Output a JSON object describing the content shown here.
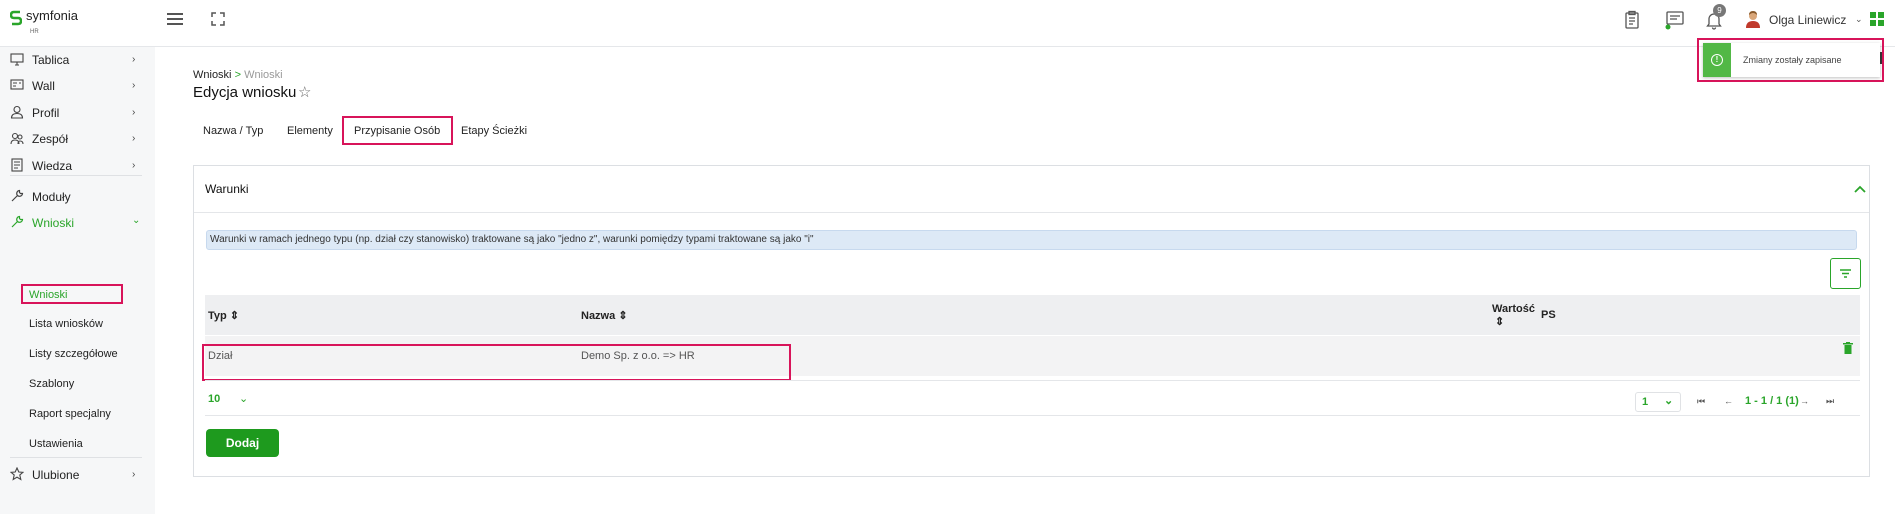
{
  "brand": {
    "name": "symfonia",
    "sub": "HR"
  },
  "header": {
    "user_name": "Olga Liniewicz",
    "notification_count": "9",
    "icons": [
      "hamburger-icon",
      "fullscreen-icon",
      "clipboard-icon",
      "chat-icon",
      "bell-icon",
      "apps-icon"
    ]
  },
  "sidebar": {
    "items": [
      {
        "label": "Tablica",
        "icon": "monitor-icon"
      },
      {
        "label": "Wall",
        "icon": "wall-icon"
      },
      {
        "label": "Profil",
        "icon": "user-icon"
      },
      {
        "label": "Zespół",
        "icon": "team-icon"
      },
      {
        "label": "Wiedza",
        "icon": "book-icon"
      },
      {
        "label": "Moduły",
        "icon": "wrench-icon"
      },
      {
        "label": "Wnioski",
        "icon": "wrench-icon"
      }
    ],
    "sub_items": [
      "Wnioski",
      "Lista wniosków",
      "Listy szczegółowe",
      "Szablony",
      "Raport specjalny",
      "Ustawienia"
    ],
    "favorites": "Ulubione"
  },
  "breadcrumb": {
    "parent": "Wnioski",
    "separator": ">",
    "current": "Wnioski"
  },
  "page_title": "Edycja wniosku",
  "tabs": [
    {
      "label": "Nazwa / Typ"
    },
    {
      "label": "Elementy"
    },
    {
      "label": "Przypisanie Osób"
    },
    {
      "label": "Etapy Ścieżki"
    }
  ],
  "card": {
    "title": "Warunki",
    "info": "Warunki w ramach jednego typu (np. dział czy stanowisko) traktowane są jako \"jedno z\", warunki pomiędzy typami traktowane są jako \"i\"",
    "columns": {
      "typ": "Typ",
      "nazwa": "Nazwa",
      "wartosc": "Wartość",
      "ps": "PS"
    },
    "rows": [
      {
        "typ": "Dział",
        "nazwa": "Demo Sp. z o.o. => HR"
      }
    ],
    "page_size": "10",
    "page": "1",
    "page_info": "1 - 1 / 1 (1)",
    "add_label": "Dodaj"
  },
  "toast": {
    "message": "Zmiany zostały zapisane"
  },
  "colors": {
    "accent": "#2aa52a",
    "highlight": "#d8145a",
    "info_bg": "#dde9f6"
  }
}
